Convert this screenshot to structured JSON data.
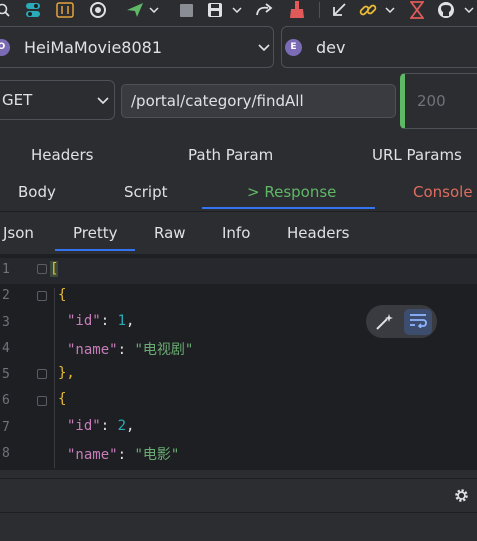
{
  "toolbar": {
    "icons": [
      "search-icon",
      "toggle-icon",
      "settings-sliders-icon",
      "record-icon",
      "run-icon",
      "stop-icon",
      "save-icon",
      "redo-icon",
      "clean-icon",
      "import-icon",
      "link-icon",
      "hourglass-icon",
      "github-icon"
    ]
  },
  "project_selector": {
    "badge": "O",
    "value": "HeiMaMovie8081"
  },
  "env_selector": {
    "badge": "E",
    "value": "dev"
  },
  "request": {
    "method": "GET",
    "url": "/portal/category/findAll",
    "status_placeholder": "200"
  },
  "tabs_row1": [
    "Headers",
    "Path Param",
    "URL Params"
  ],
  "tabs_row2": [
    "Body",
    "Script",
    "> Response",
    "Console"
  ],
  "tabs_row3": [
    "Json",
    "Pretty",
    "Raw",
    "Info",
    "Headers"
  ],
  "editor": {
    "line_numbers": [
      "1",
      "2",
      "3",
      "4",
      "5",
      "6",
      "7",
      "8"
    ],
    "lines": [
      {
        "open": "["
      },
      {
        "open": "{"
      },
      {
        "key": "\"id\"",
        "sep": ": ",
        "num": "1",
        "end": ","
      },
      {
        "key": "\"name\"",
        "sep": ": ",
        "str": "\"电视剧\""
      },
      {
        "close": "},"
      },
      {
        "open": "{"
      },
      {
        "key": "\"id\"",
        "sep": ": ",
        "num": "2",
        "end": ","
      },
      {
        "key": "\"name\"",
        "sep": ": ",
        "str": "\"电影\""
      }
    ]
  },
  "colors": {
    "accent_green": "#5fb865",
    "accent_blue": "#3574f0",
    "console_red": "#e06c5f",
    "json_key": "#c77dbb",
    "json_string": "#6aab73",
    "json_number": "#2aacb8"
  }
}
